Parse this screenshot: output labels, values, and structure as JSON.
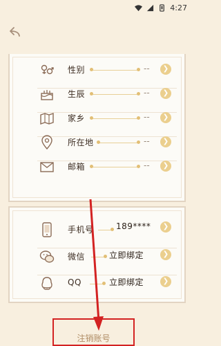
{
  "status_bar": {
    "time": "4:27"
  },
  "profile": {
    "rows": [
      {
        "label": "性别",
        "value": "--",
        "icon": "gender-icon"
      },
      {
        "label": "生辰",
        "value": "--",
        "icon": "cake-icon"
      },
      {
        "label": "家乡",
        "value": "--",
        "icon": "map-icon"
      },
      {
        "label": "所在地",
        "value": "--",
        "icon": "location-pin-icon"
      },
      {
        "label": "邮箱",
        "value": "--",
        "icon": "mail-icon"
      }
    ]
  },
  "accounts": {
    "rows": [
      {
        "label": "手机号",
        "value": "189****",
        "icon": "phone-icon"
      },
      {
        "label": "微信",
        "value": "立即绑定",
        "icon": "wechat-icon"
      },
      {
        "label": "QQ",
        "value": "立即绑定",
        "icon": "qq-icon"
      }
    ]
  },
  "deactivate_label": "注销账号",
  "annotation_color": "#d32222",
  "accent_color": "#ebcf8e"
}
